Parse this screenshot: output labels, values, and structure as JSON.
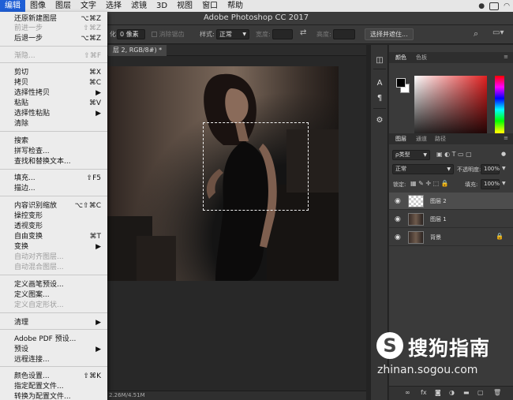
{
  "menubar": {
    "items": [
      "编辑",
      "图像",
      "图层",
      "文字",
      "选择",
      "滤镜",
      "3D",
      "视图",
      "窗口",
      "帮助"
    ],
    "active_index": 0
  },
  "app_title": "Adobe Photoshop CC 2017",
  "options": {
    "feather_suffix": "化:",
    "feather_value": "0 像素",
    "anti_alias": "消除锯齿",
    "style_label": "样式:",
    "style_value": "正常",
    "width_label": "宽度:",
    "height_label": "高度:",
    "select_mask": "选择并遮住..."
  },
  "document": {
    "tab_label": "层 2, RGB/8#) *",
    "status": "2.26M/4.51M"
  },
  "edit_menu": {
    "items": [
      {
        "label": "还原新建图层",
        "shortcut": "⌥⌘Z",
        "disabled": false
      },
      {
        "label": "前进一步",
        "shortcut": "⇧⌘Z",
        "disabled": true
      },
      {
        "label": "后退一步",
        "shortcut": "⌥⌘Z",
        "disabled": false
      },
      {
        "label": "渐隐...",
        "shortcut": "⇧⌘F",
        "disabled": true
      },
      {
        "label": "剪切",
        "shortcut": "⌘X",
        "disabled": false
      },
      {
        "label": "拷贝",
        "shortcut": "⌘C",
        "disabled": false
      },
      {
        "label": "选择性拷贝",
        "shortcut": "▶",
        "disabled": false
      },
      {
        "label": "粘贴",
        "shortcut": "⌘V",
        "disabled": false
      },
      {
        "label": "选择性粘贴",
        "shortcut": "▶",
        "disabled": false
      },
      {
        "label": "清除",
        "shortcut": "",
        "disabled": false
      },
      {
        "label": "搜索",
        "shortcut": "",
        "disabled": false
      },
      {
        "label": "拼写检查...",
        "shortcut": "",
        "disabled": false
      },
      {
        "label": "查找和替换文本...",
        "shortcut": "",
        "disabled": false
      },
      {
        "label": "填充...",
        "shortcut": "⇧F5",
        "disabled": false
      },
      {
        "label": "描边...",
        "shortcut": "",
        "disabled": false
      },
      {
        "label": "内容识别缩放",
        "shortcut": "⌥⇧⌘C",
        "disabled": false
      },
      {
        "label": "操控变形",
        "shortcut": "",
        "disabled": false
      },
      {
        "label": "透视变形",
        "shortcut": "",
        "disabled": false
      },
      {
        "label": "自由变换",
        "shortcut": "⌘T",
        "disabled": false
      },
      {
        "label": "变换",
        "shortcut": "▶",
        "disabled": false
      },
      {
        "label": "自动对齐图层...",
        "shortcut": "",
        "disabled": true
      },
      {
        "label": "自动混合图层...",
        "shortcut": "",
        "disabled": true
      },
      {
        "label": "定义画笔预设...",
        "shortcut": "",
        "disabled": false
      },
      {
        "label": "定义图案...",
        "shortcut": "",
        "disabled": false
      },
      {
        "label": "定义自定形状...",
        "shortcut": "",
        "disabled": true
      },
      {
        "label": "清理",
        "shortcut": "▶",
        "disabled": false
      },
      {
        "label": "Adobe PDF 预设...",
        "shortcut": "",
        "disabled": false
      },
      {
        "label": "预设",
        "shortcut": "▶",
        "disabled": false
      },
      {
        "label": "远程连接...",
        "shortcut": "",
        "disabled": false
      },
      {
        "label": "颜色设置...",
        "shortcut": "⇧⌘K",
        "disabled": false
      },
      {
        "label": "指定配置文件...",
        "shortcut": "",
        "disabled": false
      },
      {
        "label": "转换为配置文件...",
        "shortcut": "",
        "disabled": false
      }
    ]
  },
  "color_panel": {
    "tabs": [
      "颜色",
      "色板"
    ]
  },
  "layers_panel": {
    "tabs": [
      "图层",
      "通道",
      "路径"
    ],
    "filter_kind": "ρ类型",
    "blend_mode": "正常",
    "opacity_label": "不透明度:",
    "opacity_value": "100%",
    "lock_label": "锁定:",
    "fill_label": "填充:",
    "fill_value": "100%",
    "layers": [
      {
        "name": "图层 2",
        "selected": true
      },
      {
        "name": "图层 1",
        "selected": false
      },
      {
        "name": "背景",
        "selected": false
      }
    ]
  },
  "watermark": {
    "brand": "搜狗指南",
    "url": "zhinan.sogou.com"
  },
  "colors": {
    "menu_highlight": "#1f5fd6",
    "ps_panel": "#3a3a3a",
    "ps_canvas": "#282828"
  }
}
